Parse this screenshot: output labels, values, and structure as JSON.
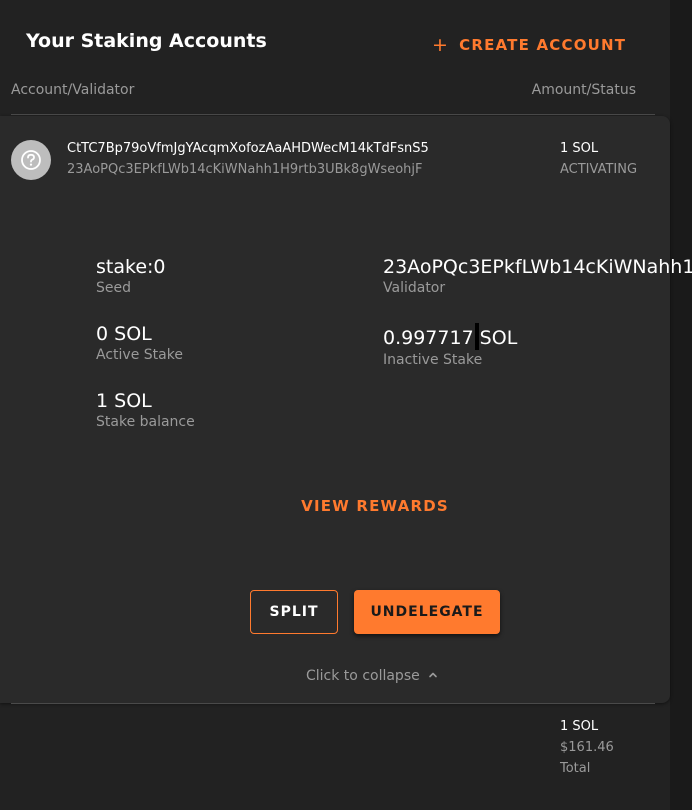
{
  "header": {
    "title": "Your Staking Accounts",
    "create_label": "CREATE ACCOUNT",
    "create_icon": "plus-icon"
  },
  "columns": {
    "left": "Account/Validator",
    "right": "Amount/Status"
  },
  "account": {
    "icon": "question-circle-icon",
    "id": "CtTC7Bp79oVfmJgYAcqmXofozAaAHDWecM14kTdFsnS5",
    "validator": "23AoPQc3EPkfLWb14cKiWNahh1H9rtb3UBk8gWseohjF",
    "amount": "1 SOL",
    "status": "ACTIVATING"
  },
  "details": {
    "seed_value": "stake:0",
    "seed_label": "Seed",
    "validator_value": "23AoPQc3EPkfLWb14cKiWNahh1",
    "validator_label": "Validator",
    "active_value": "0 SOL",
    "active_label": "Active Stake",
    "inactive_value_a": "0.997717",
    "inactive_value_b": "SOL",
    "inactive_label": "Inactive Stake",
    "balance_value": "1 SOL",
    "balance_label": "Stake balance"
  },
  "actions": {
    "view_rewards": "VIEW REWARDS",
    "split": "SPLIT",
    "undelegate": "UNDELEGATE",
    "collapse": "Click to collapse",
    "collapse_icon": "chevron-up-icon"
  },
  "totals": {
    "amount": "1 SOL",
    "usd": "$161.46",
    "label": "Total"
  },
  "colors": {
    "accent": "#ff7a2e",
    "background": "#1a1a1a",
    "panel": "#222222",
    "card": "#2a2a2a"
  }
}
